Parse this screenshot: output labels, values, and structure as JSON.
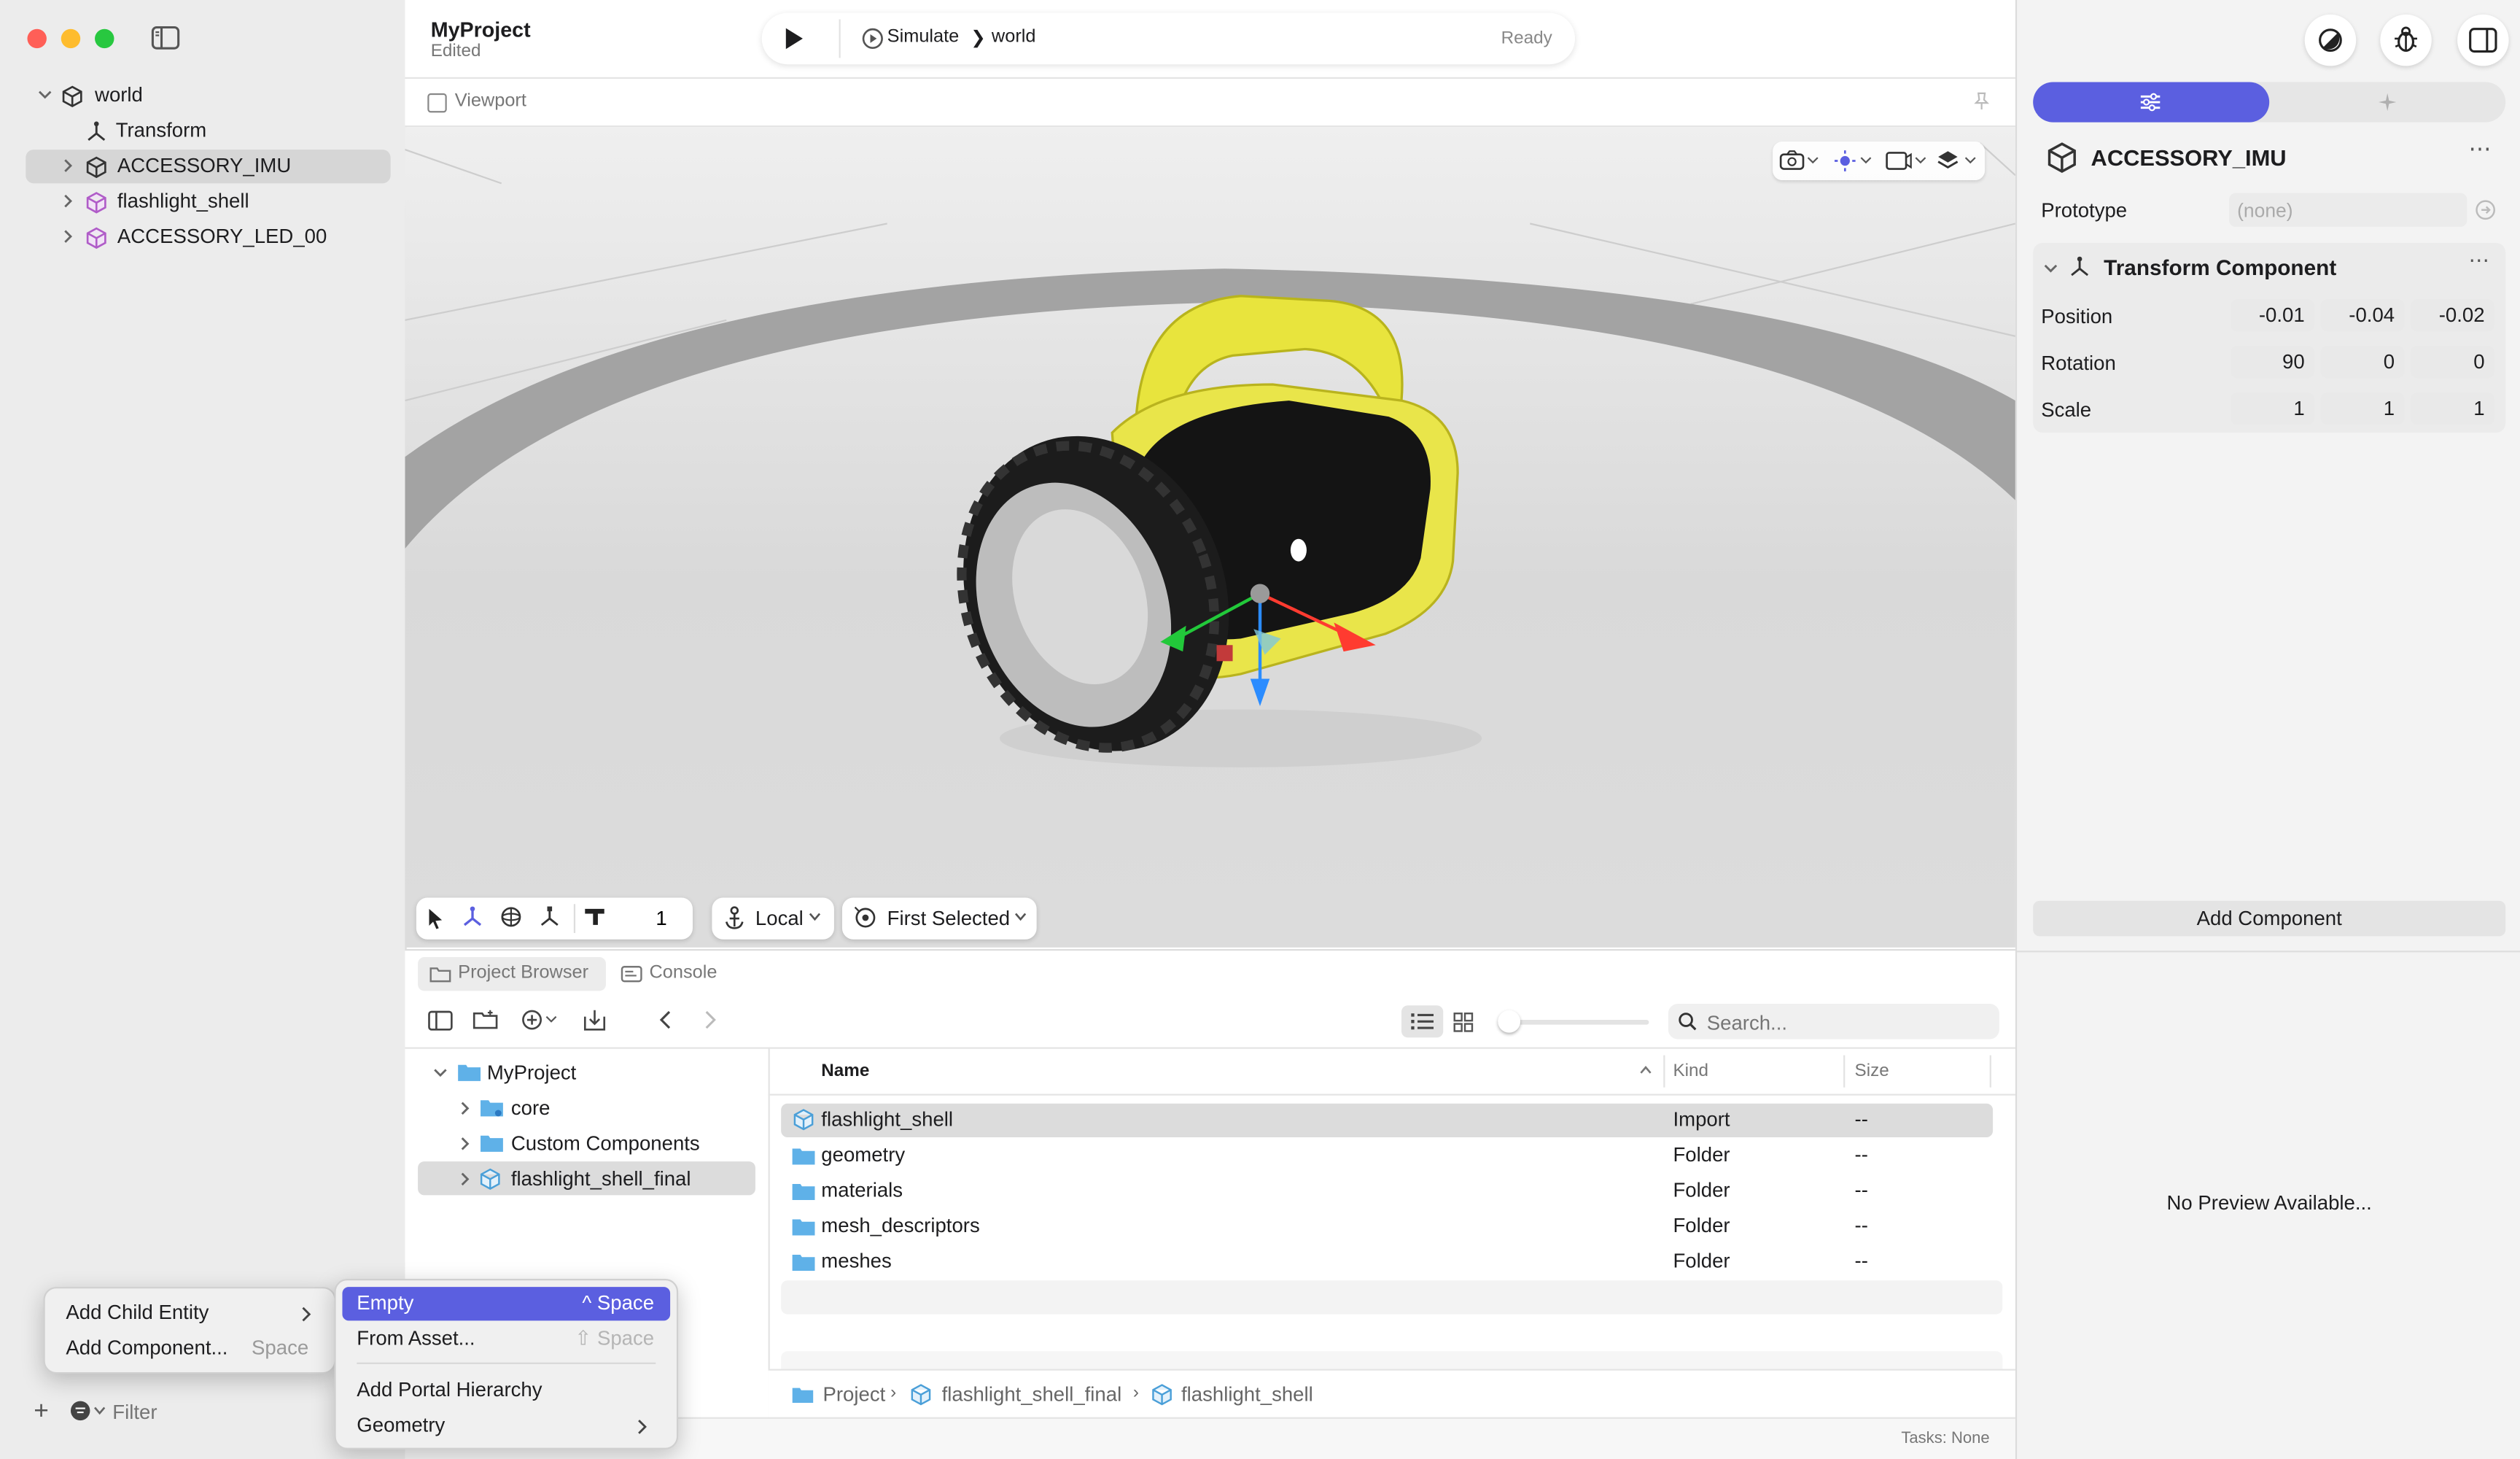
{
  "window": {
    "traffic_lights": [
      "#ff5f57",
      "#febc2e",
      "#28c840"
    ],
    "accent": "#5b5fe0"
  },
  "header": {
    "project_name": "MyProject",
    "project_status": "Edited",
    "simulate_label": "Simulate",
    "breadcrumb_world": "world",
    "status": "Ready"
  },
  "hierarchy": {
    "items": [
      {
        "label": "world",
        "icon": "cube-icon"
      },
      {
        "label": "Transform",
        "icon": "transform-axes-icon"
      },
      {
        "label": "ACCESSORY_IMU",
        "icon": "cube-icon"
      },
      {
        "label": "flashlight_shell",
        "icon": "purple-cube-icon"
      },
      {
        "label": "ACCESSORY_LED_00",
        "icon": "purple-cube-icon"
      }
    ],
    "filter_placeholder": "Filter"
  },
  "viewport": {
    "tab_label": "Viewport",
    "toolbar": {
      "step_value": "1",
      "space_label": "Local",
      "pivot_label": "First Selected"
    }
  },
  "bottom_tabs": {
    "project_browser": "Project Browser",
    "console": "Console"
  },
  "project_browser": {
    "search_placeholder": "Search...",
    "tree": [
      {
        "label": "MyProject"
      },
      {
        "label": "core"
      },
      {
        "label": "Custom Components"
      },
      {
        "label": "flashlight_shell_final"
      }
    ],
    "columns": {
      "name": "Name",
      "kind": "Kind",
      "size": "Size"
    },
    "rows": [
      {
        "name": "flashlight_shell",
        "kind": "Import",
        "size": "--"
      },
      {
        "name": "geometry",
        "kind": "Folder",
        "size": "--"
      },
      {
        "name": "materials",
        "kind": "Folder",
        "size": "--"
      },
      {
        "name": "mesh_descriptors",
        "kind": "Folder",
        "size": "--"
      },
      {
        "name": "meshes",
        "kind": "Folder",
        "size": "--"
      }
    ],
    "path": [
      "Project",
      "flashlight_shell_final",
      "flashlight_shell"
    ],
    "tasks": "Tasks: None"
  },
  "inspector": {
    "entity_name": "ACCESSORY_IMU",
    "prototype_label": "Prototype",
    "prototype_value": "(none)",
    "component_title": "Transform Component",
    "position_label": "Position",
    "position": [
      "-0.01",
      "-0.04",
      "-0.02"
    ],
    "rotation_label": "Rotation",
    "rotation": [
      "90",
      "0",
      "0"
    ],
    "scale_label": "Scale",
    "scale": [
      "1",
      "1",
      "1"
    ],
    "add_component": "Add Component",
    "no_preview": "No Preview Available..."
  },
  "context_menu": {
    "items": [
      {
        "label": "Add Child Entity",
        "shortcut": ""
      },
      {
        "label": "Add Component...",
        "shortcut": "Space"
      }
    ]
  },
  "submenu": {
    "items": [
      {
        "label": "Empty",
        "shortcut": "^ Space"
      },
      {
        "label": "From Asset...",
        "shortcut": "⇧ Space"
      },
      {
        "label": "Add Portal Hierarchy",
        "shortcut": ""
      },
      {
        "label": "Geometry",
        "shortcut": ""
      }
    ]
  }
}
